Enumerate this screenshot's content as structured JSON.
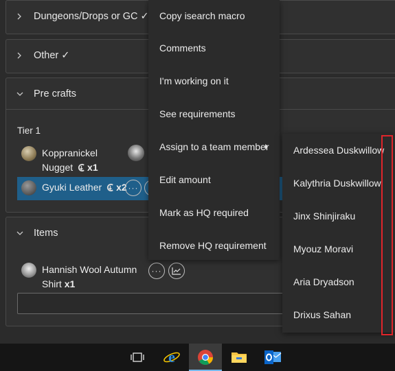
{
  "sections": {
    "dungeons": {
      "label": "Dungeons/Drops or GC ✓"
    },
    "other": {
      "label": "Other ✓"
    },
    "precrafts": {
      "label": "Pre crafts",
      "tier": "Tier 1"
    },
    "items": {
      "label": "Items"
    }
  },
  "precraft_items": [
    {
      "name_line1": "Koppranickel",
      "name_line2": "Nugget",
      "qty": "x1"
    },
    {
      "name_line1": "Gyuki Leather",
      "qty": "x2"
    }
  ],
  "final_items": [
    {
      "name_line1": "Hannish Wool Autumn",
      "name_line2": "Shirt",
      "qty": "x1"
    }
  ],
  "context_menu": [
    "Copy isearch macro",
    "Comments",
    "I'm working on it",
    "See requirements",
    "Assign to a team member",
    "Edit amount",
    "Mark as HQ required",
    "Remove HQ requirement"
  ],
  "team_members": [
    "Ardessea Duskwillow",
    "Kalythria Duskwillow",
    "Jinx Shinjiraku",
    "Myouz Moravi",
    "Aria Dryadson",
    "Drixus Sahan"
  ],
  "buttons": {
    "more": "···"
  },
  "colors": {
    "selected_row": "#1f5f8a",
    "highlight_box": "#e0252b",
    "taskbar_accent": "#76b9ed"
  },
  "taskbar_icons": [
    "task-view-icon",
    "internet-explorer-icon",
    "chrome-icon",
    "file-explorer-icon",
    "outlook-icon"
  ]
}
